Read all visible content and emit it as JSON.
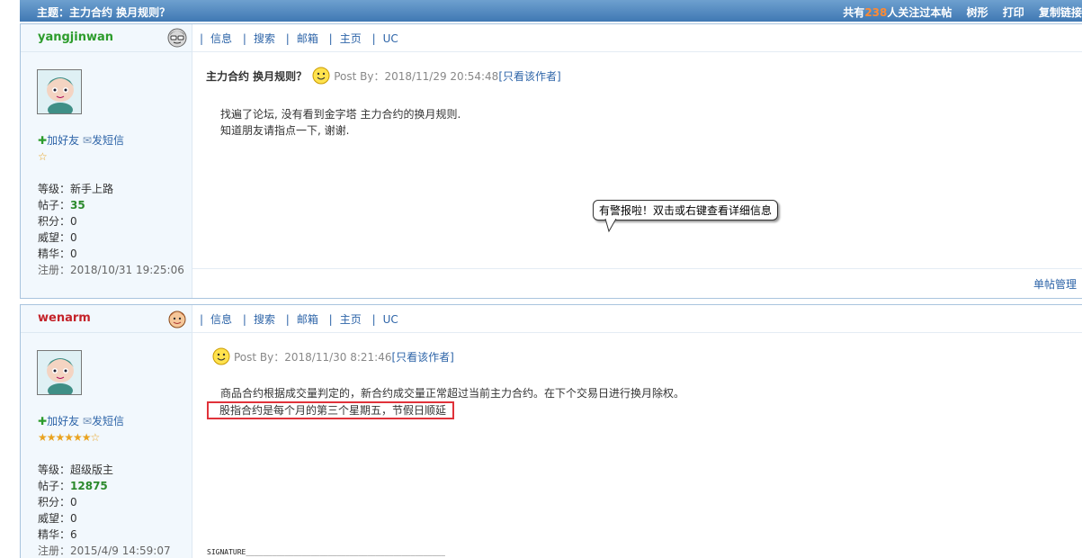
{
  "topbar": {
    "title": "主题：主力合约 换月规则？",
    "count_prefix": "共有",
    "count": "238",
    "count_suffix": "人关注过本帖",
    "links": [
      "树形",
      "打印",
      "复制链接"
    ]
  },
  "nav_links": [
    "信息",
    "搜索",
    "邮箱",
    "主页",
    "UC"
  ],
  "posts": [
    {
      "username": "yangjinwan",
      "add_friend": "加好友",
      "send_msg": "发短信",
      "stars": "☆",
      "level_label": "等级：",
      "level": "新手上路",
      "posts_label": "帖子：",
      "posts": "35",
      "points": "积分：0",
      "prestige": "威望：0",
      "essence": "精华：0",
      "registered": "注册：2018/10/31 19:25:06",
      "subject": "主力合约 换月规则？",
      "meta": "Post By：2018/11/29 20:54:48",
      "only_author": "[只看该作者]",
      "body": [
        "找遍了论坛, 没有看到金字塔 主力合约的换月规则.",
        "知道朋友请指点一下, 谢谢."
      ],
      "manage": "单帖管理"
    },
    {
      "username": "wenarm",
      "add_friend": "加好友",
      "send_msg": "发短信",
      "stars": "★★★★★★☆",
      "level_label": "等级：",
      "level": "超级版主",
      "posts_label": "帖子：",
      "posts": "12875",
      "points": "积分：0",
      "prestige": "威望：0",
      "essence": "精华：6",
      "registered": "注册：2015/4/9 14:59:07",
      "subject": "",
      "meta": "Post By：2018/11/30 8:21:46",
      "only_author": "[只看该作者]",
      "body": [
        "商品合约根据成交量判定的，新合约成交量正常超过当前主力合约。在下个交易日进行换月除权。",
        "股指合约是每个月的第三个星期五，节假日顺延"
      ],
      "signature": "SIGNATURE______________________________________________"
    }
  ],
  "tooltip": "有警报啦！双击或右键查看详细信息",
  "colors": {
    "header_blue": "#4a82bc",
    "link_blue": "#2d64a8",
    "highlight_red": "#e0323a",
    "count_orange": "#ff8a33"
  }
}
